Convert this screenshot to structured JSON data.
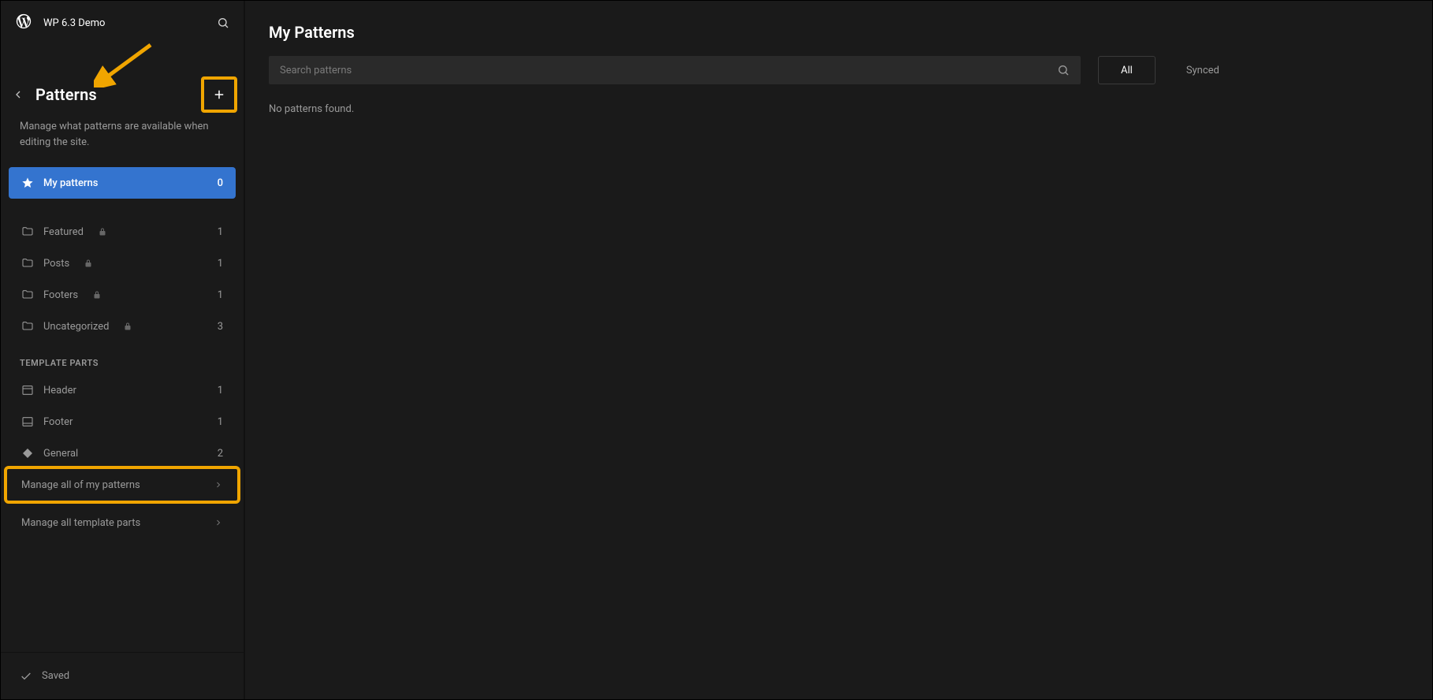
{
  "site_title": "WP 6.3 Demo",
  "section": {
    "title": "Patterns",
    "description": "Manage what patterns are available when editing the site."
  },
  "nav": {
    "primary": {
      "label": "My patterns",
      "count": 0
    },
    "categories": [
      {
        "label": "Featured",
        "count": 1,
        "locked": true
      },
      {
        "label": "Posts",
        "count": 1,
        "locked": true
      },
      {
        "label": "Footers",
        "count": 1,
        "locked": true
      },
      {
        "label": "Uncategorized",
        "count": 3,
        "locked": true
      }
    ],
    "template_parts_label": "TEMPLATE PARTS",
    "template_parts": [
      {
        "label": "Header",
        "count": 1,
        "icon": "panel-top"
      },
      {
        "label": "Footer",
        "count": 1,
        "icon": "panel-bottom"
      },
      {
        "label": "General",
        "count": 2,
        "icon": "diamond"
      }
    ],
    "manage_patterns": "Manage all of my patterns",
    "manage_templates": "Manage all template parts"
  },
  "footer_status": "Saved",
  "main": {
    "title": "My Patterns",
    "search_placeholder": "Search patterns",
    "filters": {
      "all": "All",
      "synced": "Synced"
    },
    "empty": "No patterns found."
  }
}
